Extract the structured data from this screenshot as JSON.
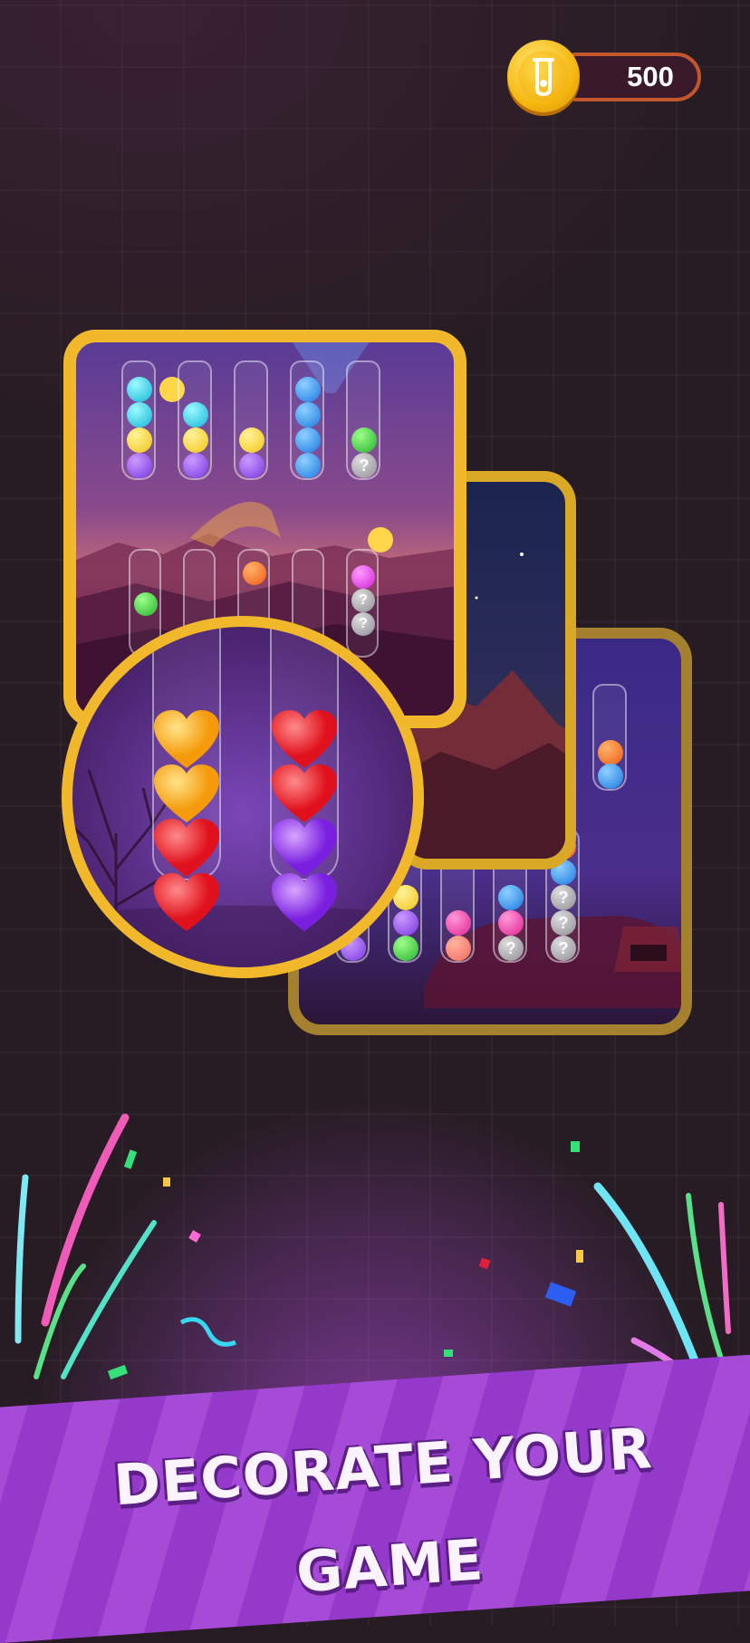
{
  "coins": {
    "value": "500",
    "icon": "coin-icon"
  },
  "headline": "DECORATE YOUR GAME",
  "colors": {
    "background": "#271c23",
    "card_border_gold": "#f2b82c",
    "banner_purple": "#a64bd8",
    "coin_bar_border": "#c2572e"
  },
  "zoom_view": {
    "left_tube": [
      "orange-heart",
      "orange-heart",
      "red-heart",
      "red-heart"
    ],
    "right_tube": [
      "red-heart",
      "red-heart",
      "purple-heart",
      "purple-heart"
    ]
  },
  "card_1": {
    "top_row": [
      [
        "cyan",
        "cyan",
        "yellow",
        "purple"
      ],
      [
        "cyan",
        "yellow",
        "purple"
      ],
      [
        "yellow",
        "purple"
      ],
      [
        "blue",
        "blue",
        "blue",
        "blue"
      ],
      [
        "green",
        "hidden"
      ]
    ],
    "hidden_label": "?"
  },
  "card_3": {
    "hidden_label": "?"
  }
}
